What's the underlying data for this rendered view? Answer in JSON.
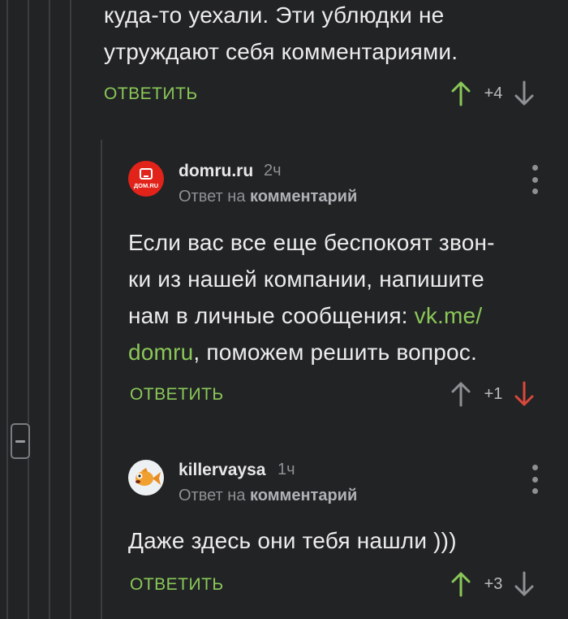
{
  "comment_top": {
    "text_line1": "куда-то уехали. Эти ублюдки не",
    "text_line2": "утруждают себя комментариями.",
    "reply_label": "ОТВЕТИТЬ",
    "score": "+4"
  },
  "comment_domru": {
    "author": "domru.ru",
    "time": "2ч",
    "reply_prefix": "Ответ на",
    "reply_target": "комментарий",
    "avatar_text": "ДОМ.RU",
    "text_line1": "Если вас все еще беспокоят звон-",
    "text_line2": "ки из нашей компании, напишите",
    "text_line3_plain": "нам в личные сообщения: ",
    "text_line3_link": "vk.me/",
    "text_line4_link": "domru",
    "text_line4_plain": ", поможем решить вопрос.",
    "reply_label": "ОТВЕТИТЬ",
    "score": "+1"
  },
  "comment_killer": {
    "author": "killervaysa",
    "time": "1ч",
    "reply_prefix": "Ответ на",
    "reply_target": "комментарий",
    "text_line1": "Даже здесь они тебя нашли )))",
    "reply_label": "ОТВЕТИТЬ",
    "score": "+3"
  },
  "colors": {
    "background": "#222325",
    "accent_green": "#8ac858",
    "downvote_red": "#d9483b",
    "text_primary": "#ececec",
    "text_muted": "#8e9194",
    "brand_red": "#e2231a"
  }
}
